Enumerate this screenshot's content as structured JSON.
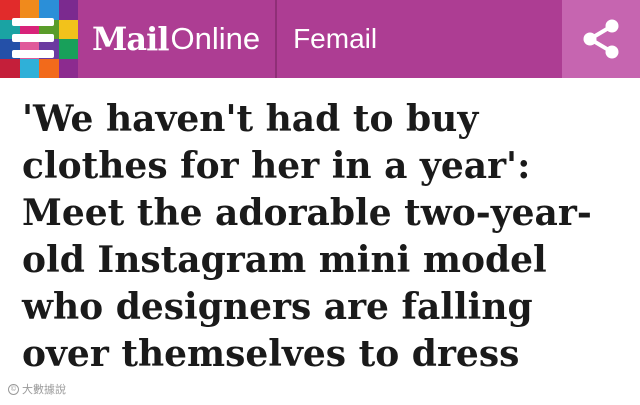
{
  "header": {
    "brand_mail": "Mail",
    "brand_online": "Online",
    "section_label": "Femail",
    "menu_icon": "menu-icon",
    "share_icon": "share-icon",
    "colors": {
      "bar": "#ad3d93",
      "share_block": "#c665b0",
      "mosaic": [
        "#e12b2b",
        "#f08a1c",
        "#2b8fd8",
        "#7b2a8f",
        "#1aa3a3",
        "#d8237a",
        "#5a9c2a",
        "#f2c21b",
        "#2450a8",
        "#e05a9a",
        "#6b3aa0",
        "#18a05a",
        "#c41f3a",
        "#2fb0d8",
        "#f26a1b",
        "#8c2b8f"
      ]
    }
  },
  "article": {
    "headline": "'We haven't had to buy\nclothes for her in a year':\nMeet the adorable two-year-\nold Instagram mini model\nwho designers are falling\nover themselves to dress"
  },
  "watermark": {
    "text": "大數據說"
  }
}
